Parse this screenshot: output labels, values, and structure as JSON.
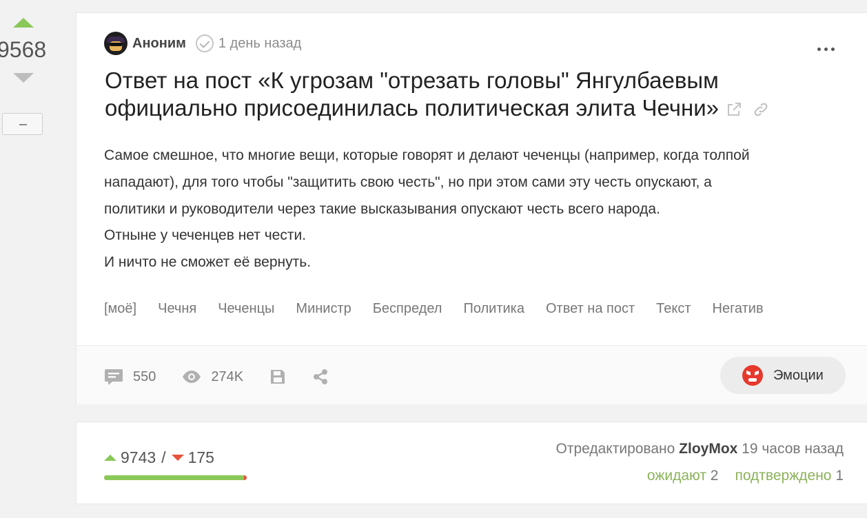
{
  "rating": {
    "value": "9568"
  },
  "story": {
    "author": "Аноним",
    "time": "1 день назад",
    "title": "Ответ на пост «К угрозам \"отрезать головы\" Янгулбаевым официально присоединилась политическая элита Чечни»",
    "body_lines": [
      "Самое смешное, что многие вещи, которые говорят и делают чеченцы (например, когда толпой",
      "нападают), для того  чтобы \"защитить свою честь\", но при этом сами эту честь опускают, а",
      "политики и руководители через такие высказывания опускают честь всего народа.",
      "Отныне у чеченцев нет чести.",
      "И ничто не сможет её вернуть."
    ],
    "tags": [
      "[моё]",
      "Чечня",
      "Чеченцы",
      "Министр",
      "Беспредел",
      "Политика",
      "Ответ на пост",
      "Текст",
      "Негатив"
    ],
    "comments": "550",
    "views": "274K",
    "emotions_label": "Эмоции"
  },
  "moderation": {
    "up_votes": "9743",
    "separator": "/",
    "down_votes": "175",
    "approval_fraction": 0.982,
    "edited_prefix": "Отредактировано",
    "editor": "ZloyMox",
    "edited_time": "19 часов назад",
    "pending_label": "ожидают",
    "pending_count": "2",
    "confirmed_label": "подтверждено",
    "confirmed_count": "1"
  },
  "colors": {
    "accent_green": "#8ac858",
    "negative_red": "#e7533c"
  },
  "icons": [
    "vote-up-icon",
    "vote-down-icon",
    "check-icon",
    "more-icon",
    "external-link-icon",
    "link-icon",
    "comment-icon",
    "eye-icon",
    "save-icon",
    "share-icon",
    "angry-emoji-icon"
  ]
}
